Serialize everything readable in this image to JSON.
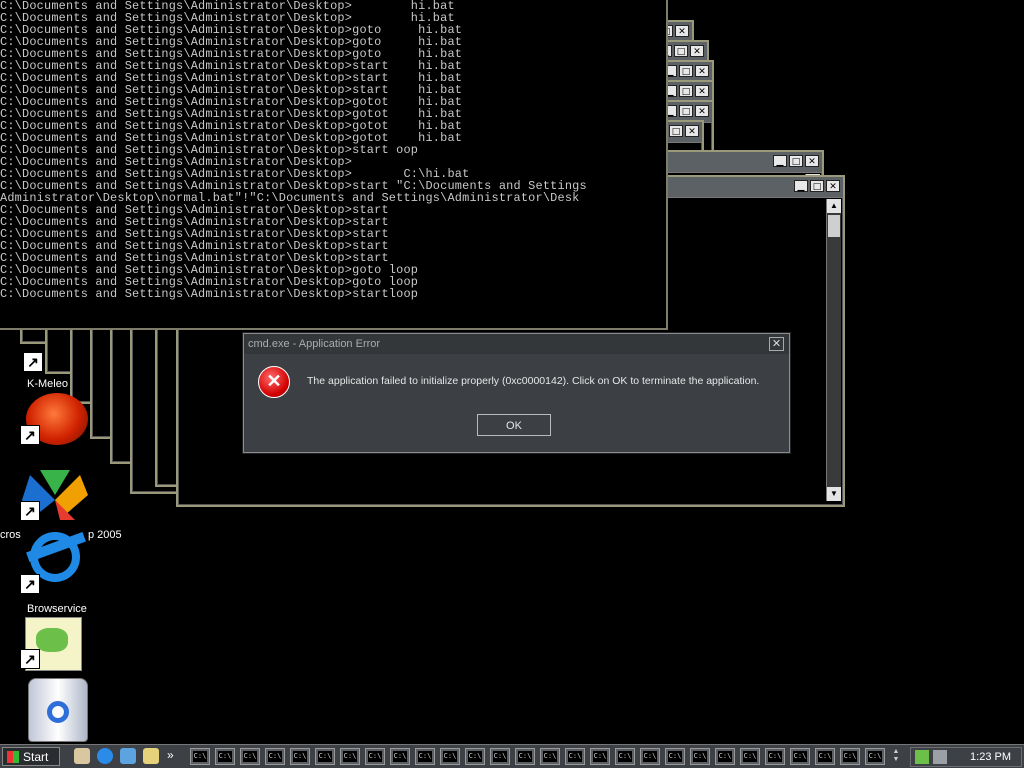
{
  "console": {
    "lines": [
      "C:\\Documents and Settings\\Administrator\\Desktop>        hi.bat",
      "C:\\Documents and Settings\\Administrator\\Desktop>        hi.bat",
      "C:\\Documents and Settings\\Administrator\\Desktop>goto     hi.bat",
      "C:\\Documents and Settings\\Administrator\\Desktop>goto     hi.bat",
      "C:\\Documents and Settings\\Administrator\\Desktop>goto     hi.bat",
      "C:\\Documents and Settings\\Administrator\\Desktop>start    hi.bat",
      "C:\\Documents and Settings\\Administrator\\Desktop>start    hi.bat",
      "C:\\Documents and Settings\\Administrator\\Desktop>start    hi.bat",
      "C:\\Documents and Settings\\Administrator\\Desktop>gotot    hi.bat",
      "C:\\Documents and Settings\\Administrator\\Desktop>gotot    hi.bat",
      "C:\\Documents and Settings\\Administrator\\Desktop>gotot    hi.bat",
      "C:\\Documents and Settings\\Administrator\\Desktop>gotot    hi.bat",
      "C:\\Documents and Settings\\Administrator\\Desktop>start oop",
      "C:\\Documents and Settings\\Administrator\\Desktop>",
      "C:\\Documents and Settings\\Administrator\\Desktop>       C:\\hi.bat",
      "C:\\Documents and Settings\\Administrator\\Desktop>start \"C:\\Documents and Settings",
      "Administrator\\Desktop\\normal.bat\"!\"C:\\Documents and Settings\\Administrator\\Desk",
      "C:\\Documents and Settings\\Administrator\\Desktop>start",
      "C:\\Documents and Settings\\Administrator\\Desktop>start",
      "C:\\Documents and Settings\\Administrator\\Desktop>start",
      "C:\\Documents and Settings\\Administrator\\Desktop>start",
      "C:\\Documents and Settings\\Administrator\\Desktop>start",
      "C:\\Documents and Settings\\Administrator\\Desktop>goto loop",
      "C:\\Documents and Settings\\Administrator\\Desktop>goto loop",
      "C:\\Documents and Settings\\Administrator\\Desktop>startloop"
    ]
  },
  "window_controls": {
    "minimize": "▁",
    "maximize": "□",
    "close": "✕"
  },
  "desktop_icons": [
    {
      "label": "K-Meleo",
      "icon": "k-meleon-icon"
    },
    {
      "label": "",
      "icon": "red-ball-icon"
    },
    {
      "label": "cros",
      "label2": "p 2005",
      "icon": "visual-studio-icon"
    },
    {
      "label": "",
      "icon": "internet-explorer-icon"
    },
    {
      "label": "Browservice",
      "icon": "notepad-plus-icon"
    },
    {
      "label": "",
      "icon": "recycle-bin-icon"
    }
  ],
  "dialog": {
    "title": "cmd.exe - Application Error",
    "message": "The application failed to initialize properly (0xc0000142). Click on OK to terminate the application.",
    "ok_label": "OK",
    "close_label": "✕",
    "error_glyph": "✕"
  },
  "taskbar": {
    "start_label": "Start",
    "overflow_label": "»",
    "task_button_glyph": "C:\\",
    "task_button_count": 28,
    "clock": "1:23 PM"
  },
  "colors": {
    "dialog_bg": "#3c4044",
    "taskbar_bg": "#3d4146",
    "error_red": "#d20000"
  }
}
